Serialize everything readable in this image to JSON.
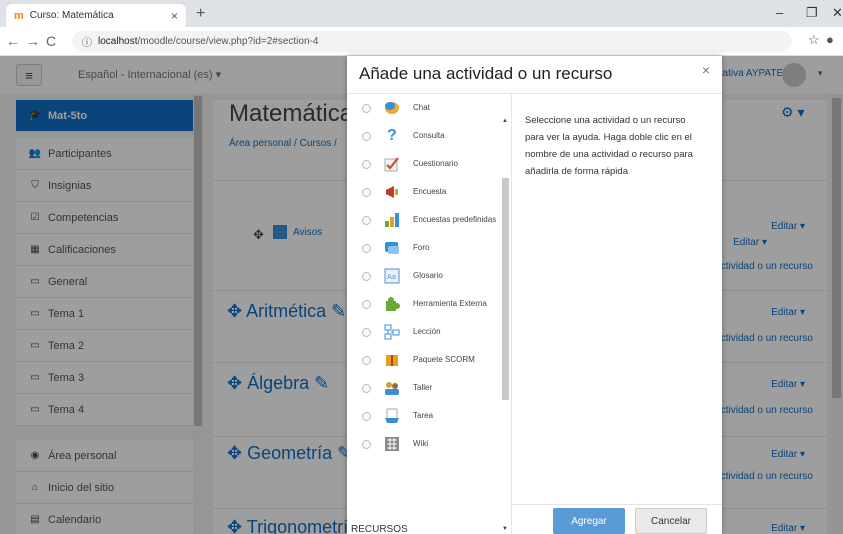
{
  "browser": {
    "tab_title": "Curso: Matemática",
    "tab_favicon": "moodle-icon",
    "url_host": "localhost",
    "url_path": "/moodle/course/view.php?id=2#section-4",
    "win_minimize": "–",
    "win_maximize": "❐",
    "win_close": "✕"
  },
  "navbar": {
    "language": "Español - Internacional (es) ▾",
    "user_text": "ucativa AYPATE"
  },
  "drawer": {
    "items": [
      {
        "label": "Mat-5to",
        "icon": "graduation-cap-icon",
        "active": true
      },
      {
        "label": "Participantes",
        "icon": "users-icon"
      },
      {
        "label": "Insignias",
        "icon": "shield-icon"
      },
      {
        "label": "Competencias",
        "icon": "check-square-icon"
      },
      {
        "label": "Calificaciones",
        "icon": "table-icon"
      },
      {
        "label": "General",
        "icon": "folder-icon"
      },
      {
        "label": "Tema 1",
        "icon": "folder-icon"
      },
      {
        "label": "Tema 2",
        "icon": "folder-icon"
      },
      {
        "label": "Tema 3",
        "icon": "folder-icon"
      },
      {
        "label": "Tema 4",
        "icon": "folder-icon"
      },
      {
        "label": "Área personal",
        "icon": "dashboard-icon"
      },
      {
        "label": "Inicio del sitio",
        "icon": "home-icon"
      },
      {
        "label": "Calendario",
        "icon": "calendar-icon"
      }
    ]
  },
  "course": {
    "title": "Matemática",
    "breadcrumb": "Área personal / Cursos /",
    "announcements": "Avisos",
    "edit_label": "Editar ▾",
    "add_label": "actividad o un recurso",
    "sections": [
      {
        "name": "Aritmética"
      },
      {
        "name": "Álgebra"
      },
      {
        "name": "Geometría"
      },
      {
        "name": "Trigonometrí"
      }
    ]
  },
  "modal": {
    "title": "Añade una actividad o un recurso",
    "close": "×",
    "help_text": "Seleccione una actividad o un recurso para ver la ayuda. Haga doble clic en el nombre de una actividad o recurso para añadirla de forma rápida",
    "recursos_label": "RECURSOS",
    "add_button": "Agregar",
    "cancel_button": "Cancelar",
    "activities": [
      {
        "name": "Chat",
        "icon": "chat-icon",
        "color": "#f0a830"
      },
      {
        "name": "Consulta",
        "icon": "question-icon",
        "color": "#3a8fd6"
      },
      {
        "name": "Cuestionario",
        "icon": "checkmark-icon",
        "color": "#d04a2c"
      },
      {
        "name": "Encuesta",
        "icon": "megaphone-icon",
        "color": "#c0392b"
      },
      {
        "name": "Encuestas predefinidas",
        "icon": "bar-chart-icon",
        "color": "#e6a020"
      },
      {
        "name": "Foro",
        "icon": "forum-icon",
        "color": "#2f8fd8"
      },
      {
        "name": "Glosario",
        "icon": "glossary-icon",
        "color": "#5a8fd6"
      },
      {
        "name": "Herramienta Externa",
        "icon": "puzzle-icon",
        "color": "#6aaa32"
      },
      {
        "name": "Lección",
        "icon": "lesson-icon",
        "color": "#3a8fd6"
      },
      {
        "name": "Paquete SCORM",
        "icon": "package-icon",
        "color": "#e6a020"
      },
      {
        "name": "Taller",
        "icon": "workshop-icon",
        "color": "#d8a030"
      },
      {
        "name": "Tarea",
        "icon": "assignment-icon",
        "color": "#3a8fd6"
      },
      {
        "name": "Wiki",
        "icon": "wiki-icon",
        "color": "#555555"
      }
    ]
  }
}
